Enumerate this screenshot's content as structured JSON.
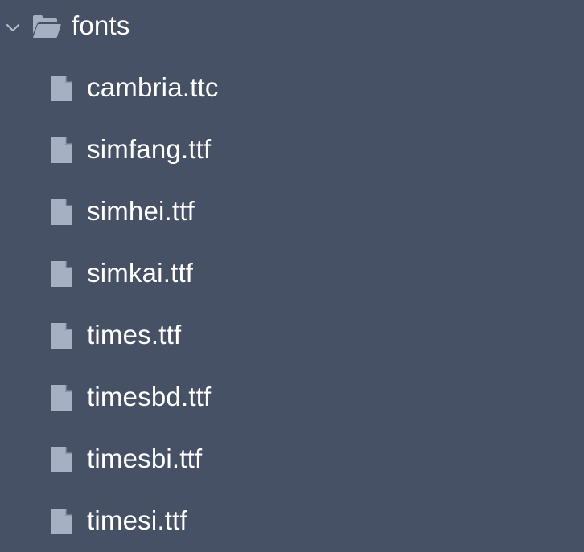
{
  "explorer": {
    "folder": {
      "name": "fonts",
      "icon": "folder-open-icon",
      "expanded": true
    },
    "files": [
      {
        "name": "cambria.ttc",
        "icon": "file-icon"
      },
      {
        "name": "simfang.ttf",
        "icon": "file-icon"
      },
      {
        "name": "simhei.ttf",
        "icon": "file-icon"
      },
      {
        "name": "simkai.ttf",
        "icon": "file-icon"
      },
      {
        "name": "times.ttf",
        "icon": "file-icon"
      },
      {
        "name": "timesbd.ttf",
        "icon": "file-icon"
      },
      {
        "name": "timesbi.ttf",
        "icon": "file-icon"
      },
      {
        "name": "timesi.ttf",
        "icon": "file-icon"
      }
    ]
  },
  "colors": {
    "background": "#475165",
    "text": "#ffffff",
    "icon": "#a7b0c2",
    "chevron": "#b8bfcc"
  }
}
